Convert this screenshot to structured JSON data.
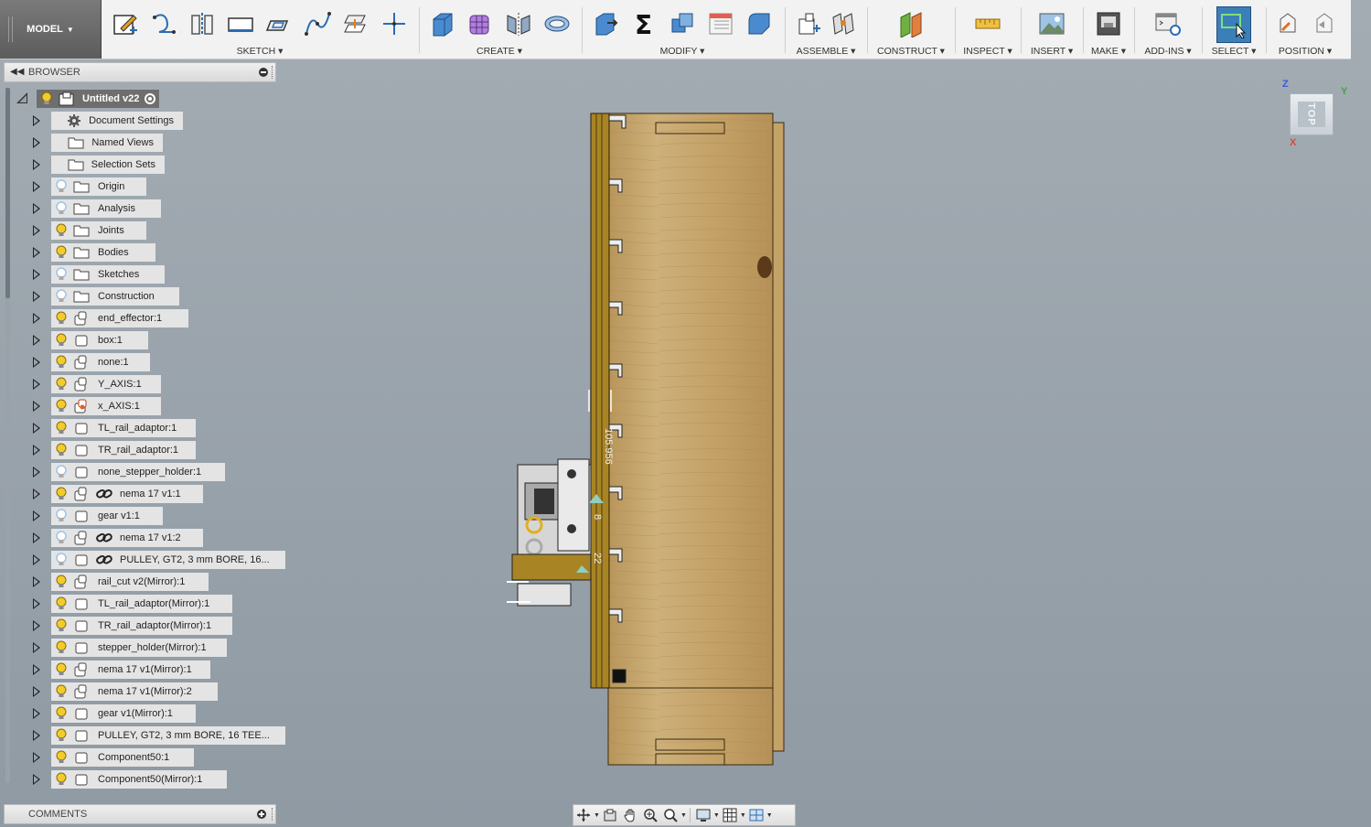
{
  "toolbar": {
    "workspace": "MODEL",
    "groups": {
      "sketch": "SKETCH ▾",
      "create": "CREATE ▾",
      "modify": "MODIFY ▾",
      "assemble": "ASSEMBLE ▾",
      "construct": "CONSTRUCT ▾",
      "inspect": "INSPECT ▾",
      "insert": "INSERT ▾",
      "make": "MAKE ▾",
      "addins": "ADD-INS ▾",
      "select": "SELECT ▾",
      "position": "POSITION ▾"
    }
  },
  "browser": {
    "title": "BROWSER",
    "root": "Untitled v22",
    "items": [
      {
        "label": "Document Settings",
        "bulb": "none",
        "icon": "gear"
      },
      {
        "label": "Named Views",
        "bulb": "none",
        "icon": "folder"
      },
      {
        "label": "Selection Sets",
        "bulb": "none",
        "icon": "folder"
      },
      {
        "label": "Origin",
        "bulb": "off",
        "icon": "folder"
      },
      {
        "label": "Analysis",
        "bulb": "off",
        "icon": "folder"
      },
      {
        "label": "Joints",
        "bulb": "on",
        "icon": "folder"
      },
      {
        "label": "Bodies",
        "bulb": "on",
        "icon": "folder"
      },
      {
        "label": "Sketches",
        "bulb": "off",
        "icon": "folder"
      },
      {
        "label": "Construction",
        "bulb": "off",
        "icon": "folder"
      },
      {
        "label": "end_effector:1",
        "bulb": "on",
        "icon": "component-multi"
      },
      {
        "label": "box:1",
        "bulb": "on",
        "icon": "component"
      },
      {
        "label": "none:1",
        "bulb": "on",
        "icon": "component-multi"
      },
      {
        "label": "Y_AXIS:1",
        "bulb": "on",
        "icon": "component-multi"
      },
      {
        "label": "x_AXIS:1",
        "bulb": "on",
        "icon": "component-active"
      },
      {
        "label": "TL_rail_adaptor:1",
        "bulb": "on",
        "icon": "component"
      },
      {
        "label": "TR_rail_adaptor:1",
        "bulb": "on",
        "icon": "component"
      },
      {
        "label": "none_stepper_holder:1",
        "bulb": "off",
        "icon": "component"
      },
      {
        "label": "nema 17 v1:1",
        "bulb": "on",
        "icon": "component-multi",
        "link": true
      },
      {
        "label": "gear v1:1",
        "bulb": "off",
        "icon": "component"
      },
      {
        "label": "nema 17 v1:2",
        "bulb": "off",
        "icon": "component-multi",
        "link": true
      },
      {
        "label": "PULLEY, GT2, 3 mm BORE,  16...",
        "bulb": "off",
        "icon": "component",
        "link": true
      },
      {
        "label": "rail_cut v2(Mirror):1",
        "bulb": "on",
        "icon": "component-multi"
      },
      {
        "label": "TL_rail_adaptor(Mirror):1",
        "bulb": "on",
        "icon": "component"
      },
      {
        "label": "TR_rail_adaptor(Mirror):1",
        "bulb": "on",
        "icon": "component"
      },
      {
        "label": "stepper_holder(Mirror):1",
        "bulb": "on",
        "icon": "component"
      },
      {
        "label": "nema 17 v1(Mirror):1",
        "bulb": "on",
        "icon": "component-multi"
      },
      {
        "label": "nema 17 v1(Mirror):2",
        "bulb": "on",
        "icon": "component-multi"
      },
      {
        "label": "gear v1(Mirror):1",
        "bulb": "on",
        "icon": "component"
      },
      {
        "label": "PULLEY, GT2, 3 mm BORE,  16 TEE...",
        "bulb": "on",
        "icon": "component"
      },
      {
        "label": "Component50:1",
        "bulb": "on",
        "icon": "component"
      },
      {
        "label": "Component50(Mirror):1",
        "bulb": "on",
        "icon": "component"
      }
    ]
  },
  "comments": {
    "title": "COMMENTS"
  },
  "viewcube": {
    "face": "TOP",
    "axis_z": "Z",
    "axis_y": "Y",
    "axis_x": "X"
  },
  "canvas": {
    "dimension_1": "105.956",
    "dimension_2": "8",
    "dimension_3": "22"
  },
  "colors": {
    "bulb_on": "#f2cc2a",
    "bulb_off": "#9ec3e6",
    "select_active": "#3b7fb8",
    "wood": "#c7a46a",
    "rail": "#9a7a2a"
  }
}
